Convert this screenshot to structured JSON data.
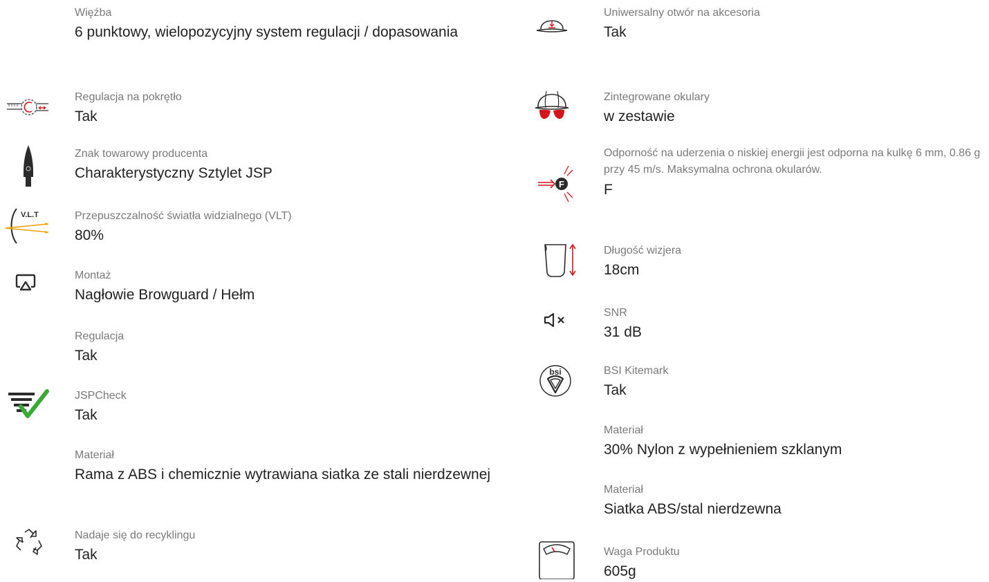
{
  "left_column": [
    {
      "key": "wiezba",
      "label": "Więźba",
      "value": "6 punktowy, wielopozycyjny system regulacji / dopasowania",
      "icon": null
    },
    {
      "key": "pokretlo",
      "label": "Regulacja na pokrętło",
      "value": "Tak",
      "icon": "ratchet-dial-icon"
    },
    {
      "key": "znak",
      "label": "Znak towarowy producenta",
      "value": "Charakterystyczny Sztylet JSP",
      "icon": "dagger-trademark-icon"
    },
    {
      "key": "vlt",
      "label": "Przepuszczalność światła widzialnego (VLT)",
      "value": "80%",
      "icon": "vlt-light-icon"
    },
    {
      "key": "montaz",
      "label": "Montaż",
      "value": "Nagłowie Browguard / Hełm",
      "icon": "mounting-icon"
    },
    {
      "key": "regulacja",
      "label": "Regulacja",
      "value": "Tak",
      "icon": null
    },
    {
      "key": "jspcheck",
      "label": "JSPCheck",
      "value": "Tak",
      "icon": "jspcheck-icon"
    },
    {
      "key": "material",
      "label": "Materiał",
      "value": "Rama z ABS i chemicznie wytrawiana siatka ze stali nierdzewnej",
      "icon": null
    },
    {
      "key": "recykling",
      "label": "Nadaje się do recyklingu",
      "value": "Tak",
      "icon": "recycle-icon"
    }
  ],
  "right_column": [
    {
      "key": "otwor",
      "label": "Uniwersalny otwór na akcesoria",
      "value": "Tak",
      "icon": "accessory-slot-helmet-icon"
    },
    {
      "key": "okulary",
      "label": "Zintegrowane okulary",
      "value": "w zestawie",
      "icon": "integrated-glasses-helmet-icon"
    },
    {
      "key": "uderzenia",
      "label": "Odporność na uderzenia o niskiej energii jest odporna na kulkę 6 mm, 0.86 g przy 45 m/s. Maksymalna ochrona okularów.",
      "value": "F",
      "icon": "impact-f-icon"
    },
    {
      "key": "wizjer",
      "label": "Długość wizjera",
      "value": "18cm",
      "icon": "visor-length-icon"
    },
    {
      "key": "snr",
      "label": "SNR",
      "value": "31 dB",
      "icon": "speaker-mute-icon"
    },
    {
      "key": "bsi",
      "label": "BSI Kitemark",
      "value": "Tak",
      "icon": "bsi-kitemark-icon"
    },
    {
      "key": "material1",
      "label": "Materiał",
      "value": "30% Nylon z wypełnieniem szklanym",
      "icon": null
    },
    {
      "key": "material2",
      "label": "Materiał",
      "value": "Siatka ABS/stal nierdzewna",
      "icon": null
    },
    {
      "key": "waga",
      "label": "Waga Produktu",
      "value": "605g",
      "icon": "scale-icon"
    }
  ],
  "icon_text": {
    "vlt": "V.L.T",
    "bsi": "bsi",
    "f": "F"
  },
  "colors": {
    "accent_red": "#d4141c",
    "accent_green": "#3aa935",
    "accent_orange": "#f0a000",
    "icon_dark": "#2b2b2b"
  }
}
